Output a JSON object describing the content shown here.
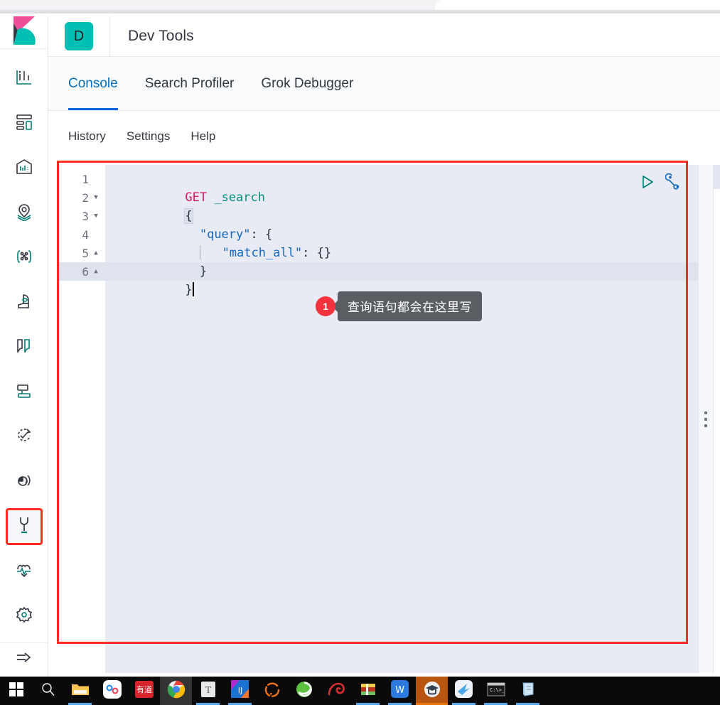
{
  "window": {
    "browser_chrome": "chrome-tab-strip"
  },
  "header": {
    "logo_name": "kibana-logo",
    "app_badge_letter": "D",
    "title": "Dev Tools"
  },
  "sidebar": {
    "items": [
      {
        "name": "sidebar-item-discover",
        "icon": "discover-icon",
        "selected": false
      },
      {
        "name": "sidebar-item-dashboard",
        "icon": "dashboard-icon",
        "selected": false
      },
      {
        "name": "sidebar-item-canvas",
        "icon": "canvas-icon",
        "selected": false
      },
      {
        "name": "sidebar-item-maps",
        "icon": "maps-pin-layers-icon",
        "selected": false
      },
      {
        "name": "sidebar-item-machine-learning",
        "icon": "machine-learning-icon",
        "selected": false
      },
      {
        "name": "sidebar-item-infrastructure",
        "icon": "infrastructure-icon",
        "selected": false
      },
      {
        "name": "sidebar-item-logs",
        "icon": "logs-icon",
        "selected": false
      },
      {
        "name": "sidebar-item-apm",
        "icon": "apm-icon",
        "selected": false
      },
      {
        "name": "sidebar-item-uptime",
        "icon": "uptime-clock-icon",
        "selected": false
      },
      {
        "name": "sidebar-item-siem",
        "icon": "siem-radar-icon",
        "selected": false
      },
      {
        "name": "sidebar-item-dev-tools",
        "icon": "wrench-icon",
        "selected": true
      },
      {
        "name": "sidebar-item-monitoring",
        "icon": "heartbeat-icon",
        "selected": false
      },
      {
        "name": "sidebar-item-management",
        "icon": "gear-icon",
        "selected": false
      }
    ],
    "footer_icon": "collapse-arrow-icon"
  },
  "tabs": [
    {
      "label": "Console",
      "active": true
    },
    {
      "label": "Search Profiler",
      "active": false
    },
    {
      "label": "Grok Debugger",
      "active": false
    }
  ],
  "submenu": [
    {
      "label": "History"
    },
    {
      "label": "Settings"
    },
    {
      "label": "Help"
    }
  ],
  "editor": {
    "lines": [
      {
        "number": "1",
        "fold": "",
        "active": false
      },
      {
        "number": "2",
        "fold": "▼",
        "active": false
      },
      {
        "number": "3",
        "fold": "▼",
        "active": false
      },
      {
        "number": "4",
        "fold": "",
        "active": false
      },
      {
        "number": "5",
        "fold": "▲",
        "active": false
      },
      {
        "number": "6",
        "fold": "▲",
        "active": true
      }
    ],
    "code": {
      "line1_method": "GET",
      "line1_url": "_search",
      "line2": "{",
      "line3_key": "\"query\"",
      "line3_rest": ": {",
      "line4_key": "\"match_all\"",
      "line4_rest": ": {}",
      "line5": "}",
      "line6": "}"
    },
    "actions": [
      {
        "name": "send-request-button",
        "icon": "play-triangle-icon",
        "color": "#017d73"
      },
      {
        "name": "request-options-button",
        "icon": "wrench-icon",
        "color": "#1668c1"
      }
    ]
  },
  "annotation": {
    "box_color": "#ff2d20",
    "callout_number": "1",
    "callout_text": "查询语句都会在这里写"
  },
  "taskbar": {
    "items": [
      {
        "name": "taskbar-start-button",
        "icon": "windows-logo-icon",
        "state": ""
      },
      {
        "name": "taskbar-search-button",
        "icon": "search-icon",
        "state": ""
      },
      {
        "name": "taskbar-file-explorer",
        "icon": "folder-icon",
        "state": "running"
      },
      {
        "name": "taskbar-baidu-netdisk",
        "icon": "cloud-disk-icon",
        "state": ""
      },
      {
        "name": "taskbar-youdao",
        "icon": "youdao-dictionary-icon",
        "state": ""
      },
      {
        "name": "taskbar-chrome",
        "icon": "chrome-icon",
        "state": "active"
      },
      {
        "name": "taskbar-typora",
        "icon": "typora-icon",
        "state": "running"
      },
      {
        "name": "taskbar-intellij-idea",
        "icon": "intellij-idea-icon",
        "state": "running"
      },
      {
        "name": "taskbar-navicat",
        "icon": "navicat-icon",
        "state": ""
      },
      {
        "name": "taskbar-internet-explorer",
        "icon": "internet-explorer-icon",
        "state": ""
      },
      {
        "name": "taskbar-snail-app",
        "icon": "snail-icon",
        "state": ""
      },
      {
        "name": "taskbar-winrar",
        "icon": "winrar-icon",
        "state": "running"
      },
      {
        "name": "taskbar-wps-office",
        "icon": "wps-icon",
        "state": "running"
      },
      {
        "name": "taskbar-study-app",
        "icon": "graduation-cap-icon",
        "state": "active-orange"
      },
      {
        "name": "taskbar-foxmail",
        "icon": "foxmail-bird-icon",
        "state": "running"
      },
      {
        "name": "taskbar-command-prompt",
        "icon": "cmd-icon",
        "state": "running"
      },
      {
        "name": "taskbar-notepad",
        "icon": "notepad-icon",
        "state": "running"
      }
    ]
  }
}
